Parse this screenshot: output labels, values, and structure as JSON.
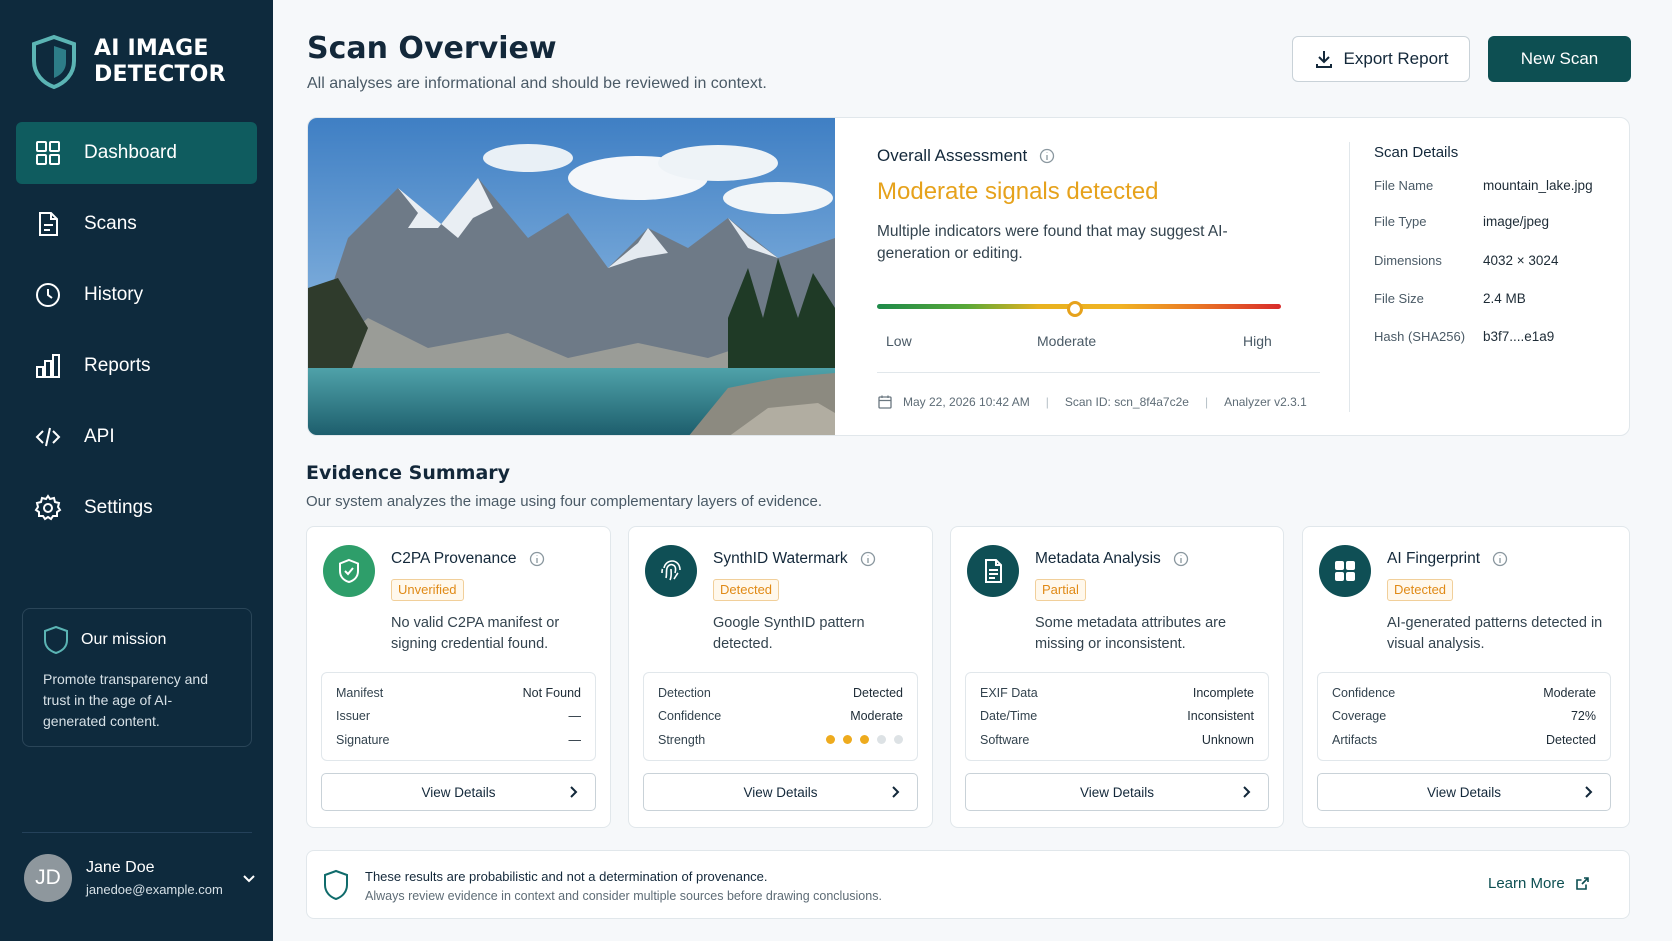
{
  "brand": {
    "line1": "AI IMAGE",
    "line2": "DETECTOR"
  },
  "nav": [
    {
      "label": "Dashboard",
      "icon": "grid-icon",
      "active": true
    },
    {
      "label": "Scans",
      "icon": "document-icon"
    },
    {
      "label": "History",
      "icon": "clock-icon"
    },
    {
      "label": "Reports",
      "icon": "bar-chart-icon"
    },
    {
      "label": "API",
      "icon": "code-icon"
    },
    {
      "label": "Settings",
      "icon": "gear-icon"
    }
  ],
  "mission": {
    "title": "Our mission",
    "text": "Promote transparency and trust in the age of AI-generated content."
  },
  "user": {
    "initials": "JD",
    "name": "Jane Doe",
    "email": "janedoe@example.com"
  },
  "header": {
    "title": "Scan Overview",
    "subtitle": "All analyses are informational and should be reviewed in context.",
    "export_label": "Export Report",
    "new_scan_label": "New Scan"
  },
  "assessment": {
    "label": "Overall Assessment",
    "result": "Moderate signals detected",
    "description": "Multiple indicators were found that may suggest AI-generation or editing.",
    "scale": {
      "low": "Low",
      "moderate": "Moderate",
      "high": "High"
    },
    "level": 0.49,
    "date": "May 22, 2026  10:42 AM",
    "scan_id": "Scan ID: scn_8f4a7c2e",
    "analyzer": "Analyzer  v2.3.1"
  },
  "scan_details": {
    "title": "Scan Details",
    "rows": [
      {
        "label": "File Name",
        "value": "mountain_lake.jpg"
      },
      {
        "label": "File Type",
        "value": "image/jpeg"
      },
      {
        "label": "Dimensions",
        "value": "4032 × 3024"
      },
      {
        "label": "File Size",
        "value": "2.4 MB"
      },
      {
        "label": "Hash (SHA256)",
        "value": "b3f7....e1a9"
      }
    ]
  },
  "evidence": {
    "title": "Evidence Summary",
    "subtitle": "Our system analyzes the image using four complementary layers of evidence.",
    "cards": [
      {
        "title": "C2PA Provenance",
        "icon": "shield-check-icon",
        "badge": "Unverified",
        "description": "No valid C2PA manifest or signing credential found.",
        "rows": [
          {
            "label": "Manifest",
            "value": "Not Found"
          },
          {
            "label": "Issuer",
            "value": "—"
          },
          {
            "label": "Signature",
            "value": "—"
          }
        ],
        "button": "View Details"
      },
      {
        "title": "SynthID Watermark",
        "icon": "fingerprint-icon",
        "badge": "Detected",
        "description": "Google SynthID pattern detected.",
        "rows": [
          {
            "label": "Detection",
            "value": "Detected"
          },
          {
            "label": "Confidence",
            "value": "Moderate"
          },
          {
            "label": "Strength",
            "value": ""
          }
        ],
        "strength": 3,
        "strength_max": 5,
        "button": "View Details"
      },
      {
        "title": "Metadata Analysis",
        "icon": "file-text-icon",
        "badge": "Partial",
        "description": "Some metadata attributes are missing or inconsistent.",
        "rows": [
          {
            "label": "EXIF Data",
            "value": "Incomplete"
          },
          {
            "label": "Date/Time",
            "value": "Inconsistent"
          },
          {
            "label": "Software",
            "value": "Unknown"
          }
        ],
        "button": "View Details"
      },
      {
        "title": "AI Fingerprint",
        "icon": "grid-icon",
        "badge": "Detected",
        "description": "AI-generated patterns detected in visual analysis.",
        "rows": [
          {
            "label": "Confidence",
            "value": "Moderate"
          },
          {
            "label": "Coverage",
            "value": "72%"
          },
          {
            "label": "Artifacts",
            "value": "Detected"
          }
        ],
        "button": "View Details"
      }
    ]
  },
  "notice": {
    "main": "These results are probabilistic and not a determination of provenance.",
    "sub": "Always review evidence in context and consider multiple sources before drawing conclusions.",
    "link": "Learn More"
  },
  "colors": {
    "sidebar": "#0e2a3d",
    "accent": "#0d4f52",
    "warning": "#e6a21c",
    "icon_green": "#2e9e6a",
    "icon_teal": "#0f4f55"
  }
}
